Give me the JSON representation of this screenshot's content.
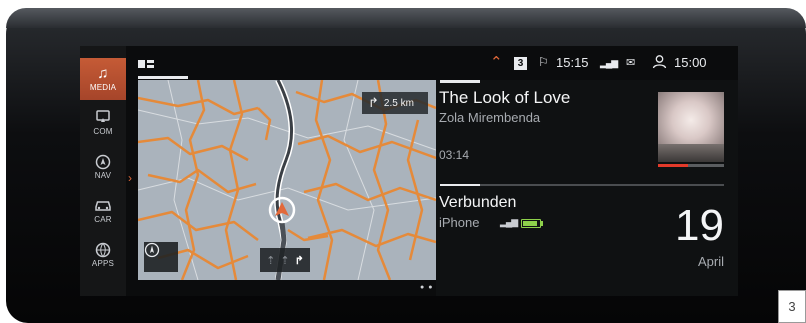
{
  "sidebar": {
    "items": [
      {
        "label": "MEDIA",
        "icon": "music-note-icon",
        "active": true
      },
      {
        "label": "COM",
        "icon": "phone-screen-icon",
        "active": false
      },
      {
        "label": "NAV",
        "icon": "navigation-icon",
        "active": false
      },
      {
        "label": "CAR",
        "icon": "car-icon",
        "active": false
      },
      {
        "label": "APPS",
        "icon": "apps-globe-icon",
        "active": false
      }
    ]
  },
  "status_bar": {
    "layout_icon": "split-view-icon",
    "collapse_icon": "chevron-up-icon",
    "badge": "3",
    "nav_time": "15:15",
    "clock": "15:00"
  },
  "map": {
    "next_turn_distance": "2.5 km",
    "compass_icon": "compass-icon",
    "turn_arrow_icon": "turn-right-icon"
  },
  "media": {
    "title": "The Look of Love",
    "artist": "Zola Mirembenda",
    "time": "03:14",
    "progress": 0.45
  },
  "phone": {
    "title": "Verbunden",
    "device": "iPhone",
    "battery_level": 0.85
  },
  "date": {
    "day": "19",
    "month": "April"
  },
  "page_number": "3",
  "colors": {
    "accent": "#e2693a",
    "active_tab": "#b9502f",
    "route": "#e58a3a",
    "battery": "#8ed14b"
  }
}
